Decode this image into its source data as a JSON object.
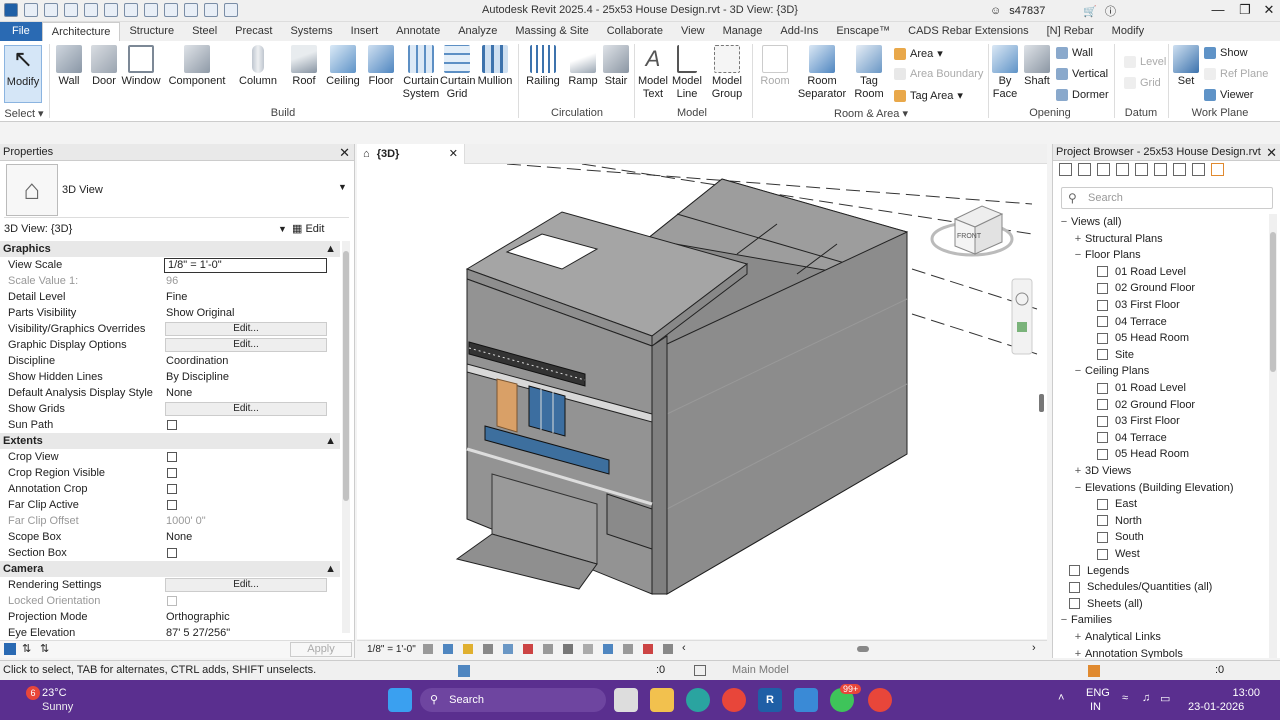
{
  "window": {
    "title": "Autodesk Revit 2025.4 - 25x53 House Design.rvt - 3D View: {3D}",
    "user": "s47837"
  },
  "tabs": [
    "File",
    "Architecture",
    "Structure",
    "Steel",
    "Precast",
    "Systems",
    "Insert",
    "Annotate",
    "Analyze",
    "Massing & Site",
    "Collaborate",
    "View",
    "Manage",
    "Add-Ins",
    "Enscape™",
    "CADS Rebar Extensions",
    "[N] Rebar",
    "Modify"
  ],
  "ribbon": {
    "select": {
      "modify": "Modify",
      "label": "Select"
    },
    "build": {
      "label": "Build",
      "buttons": [
        "Wall",
        "Door",
        "Window",
        "Component",
        "Column",
        "Roof",
        "Ceiling",
        "Floor",
        "Curtain System",
        "Curtain Grid",
        "Mullion"
      ]
    },
    "circulation": {
      "label": "Circulation",
      "buttons": [
        "Railing",
        "Ramp",
        "Stair"
      ]
    },
    "model": {
      "label": "Model",
      "buttons": [
        "Model Text",
        "Model Line",
        "Model Group"
      ]
    },
    "room": {
      "label": "Room & Area",
      "buttons": [
        "Room",
        "Room Separator",
        "Tag Room"
      ],
      "small": [
        "Area",
        "Area Boundary",
        "Tag Area"
      ]
    },
    "opening": {
      "label": "Opening",
      "buttons": [
        "By Face",
        "Shaft"
      ],
      "small": [
        "Wall",
        "Vertical",
        "Dormer"
      ]
    },
    "datum": {
      "label": "Datum",
      "small": [
        "Level",
        "Grid"
      ]
    },
    "workplane": {
      "label": "Work Plane",
      "set": "Set",
      "small": [
        "Show",
        "Ref Plane",
        "Viewer"
      ]
    }
  },
  "properties": {
    "title": "Properties",
    "type_name": "3D View",
    "selector": "3D View: {3D}",
    "edit_type": "Edit Type",
    "sections": {
      "graphics": "Graphics",
      "extents": "Extents",
      "camera": "Camera"
    },
    "rows": {
      "view_scale": {
        "k": "View Scale",
        "v": "1/8\" = 1'-0\""
      },
      "scale_value": {
        "k": "Scale Value    1:",
        "v": "96"
      },
      "detail_level": {
        "k": "Detail Level",
        "v": "Fine"
      },
      "parts_visibility": {
        "k": "Parts Visibility",
        "v": "Show Original"
      },
      "vg_overrides": {
        "k": "Visibility/Graphics Overrides",
        "v": "Edit..."
      },
      "graphic_display": {
        "k": "Graphic Display Options",
        "v": "Edit..."
      },
      "discipline": {
        "k": "Discipline",
        "v": "Coordination"
      },
      "hidden_lines": {
        "k": "Show Hidden Lines",
        "v": "By Discipline"
      },
      "analysis_style": {
        "k": "Default Analysis Display Style",
        "v": "None"
      },
      "show_grids": {
        "k": "Show Grids",
        "v": "Edit..."
      },
      "sun_path": {
        "k": "Sun Path"
      },
      "crop_view": {
        "k": "Crop View"
      },
      "crop_region": {
        "k": "Crop Region Visible"
      },
      "annotation_crop": {
        "k": "Annotation Crop"
      },
      "far_clip_active": {
        "k": "Far Clip Active"
      },
      "far_clip_offset": {
        "k": "Far Clip Offset",
        "v": "1000'  0\""
      },
      "scope_box": {
        "k": "Scope Box",
        "v": "None"
      },
      "section_box": {
        "k": "Section Box"
      },
      "rendering": {
        "k": "Rendering Settings",
        "v": "Edit..."
      },
      "locked_orientation": {
        "k": "Locked Orientation"
      },
      "projection": {
        "k": "Projection Mode",
        "v": "Orthographic"
      },
      "eye_elevation": {
        "k": "Eye Elevation",
        "v": "87'  5 27/256\""
      }
    },
    "apply": "Apply"
  },
  "view": {
    "tab": "{3D}",
    "scale": "1/8\" = 1'-0\"",
    "viewcube": "FRONT"
  },
  "browser": {
    "title": "Project Browser - 25x53 House Design.rvt",
    "search_placeholder": "Search",
    "items": [
      {
        "label": "Views (all)",
        "level": 0,
        "exp": "−"
      },
      {
        "label": "Structural Plans",
        "level": 1,
        "exp": "+"
      },
      {
        "label": "Floor Plans",
        "level": 1,
        "exp": "−"
      },
      {
        "label": "01 Road Level",
        "level": 2
      },
      {
        "label": "02 Ground Floor",
        "level": 2
      },
      {
        "label": "03 First Floor",
        "level": 2
      },
      {
        "label": "04 Terrace",
        "level": 2
      },
      {
        "label": "05 Head Room",
        "level": 2
      },
      {
        "label": "Site",
        "level": 2
      },
      {
        "label": "Ceiling Plans",
        "level": 1,
        "exp": "−"
      },
      {
        "label": "01 Road Level",
        "level": 2
      },
      {
        "label": "02 Ground Floor",
        "level": 2
      },
      {
        "label": "03 First Floor",
        "level": 2
      },
      {
        "label": "04 Terrace",
        "level": 2
      },
      {
        "label": "05 Head Room",
        "level": 2
      },
      {
        "label": "3D Views",
        "level": 1,
        "exp": "+"
      },
      {
        "label": "Elevations (Building Elevation)",
        "level": 1,
        "exp": "−"
      },
      {
        "label": "East",
        "level": 2
      },
      {
        "label": "North",
        "level": 2
      },
      {
        "label": "South",
        "level": 2
      },
      {
        "label": "West",
        "level": 2
      },
      {
        "label": "Legends",
        "level": 0
      },
      {
        "label": "Schedules/Quantities (all)",
        "level": 0
      },
      {
        "label": "Sheets (all)",
        "level": 0
      },
      {
        "label": "Families",
        "level": 0,
        "exp": "−"
      },
      {
        "label": "Analytical Links",
        "level": 1,
        "exp": "+"
      },
      {
        "label": "Annotation Symbols",
        "level": 1,
        "exp": "+"
      }
    ]
  },
  "status": {
    "hint": "Click to select, TAB for alternates, CTRL adds, SHIFT unselects.",
    "zero1": ":0",
    "model": "Main Model",
    "zero2": ":0"
  },
  "taskbar": {
    "temp": "23°C",
    "weather": "Sunny",
    "badge": "6",
    "search": "Search",
    "lang1": "ENG",
    "lang2": "IN",
    "time": "13:00",
    "date": "23-01-2026",
    "notif": "99+"
  },
  "colors": {
    "file_tab": "#2a6ab3",
    "taskbar": "#5a2f8f",
    "wall": "#8a8a8a"
  }
}
